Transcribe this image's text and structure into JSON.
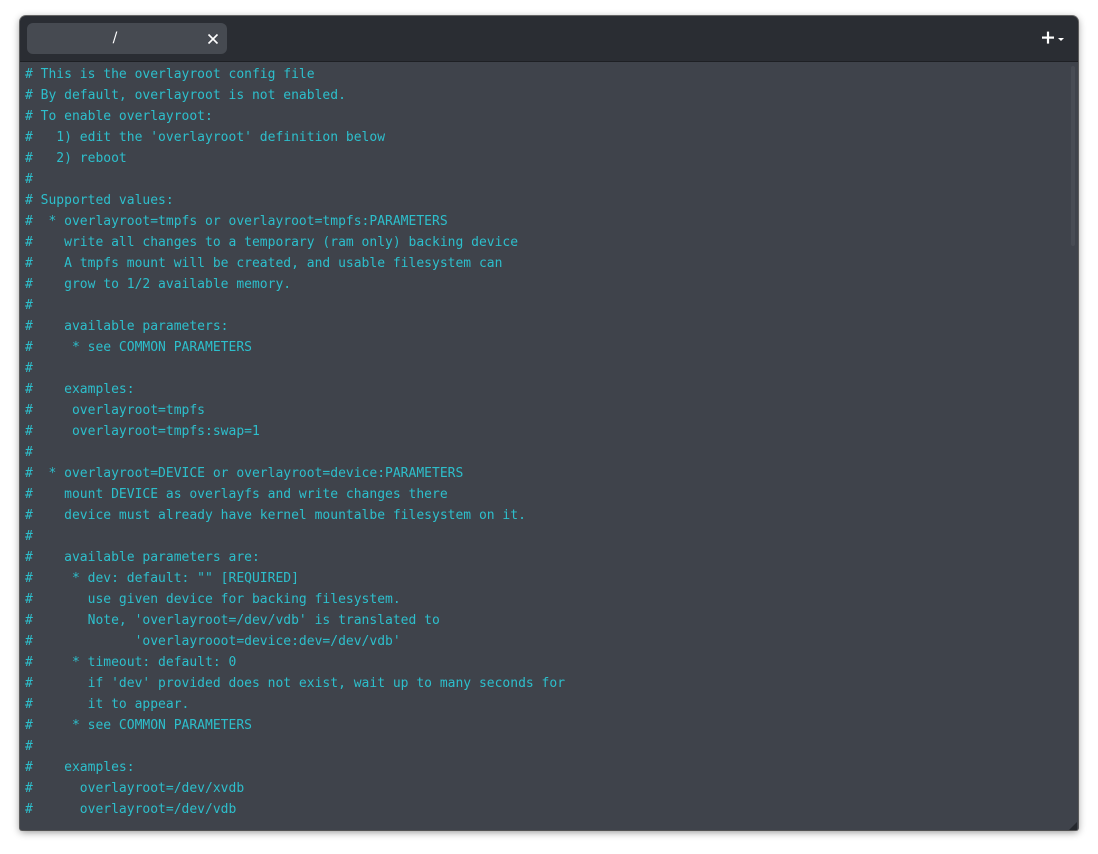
{
  "window": {
    "tab_title": "/",
    "colors": {
      "titlebar": "#2a2d33",
      "tab": "#464a51",
      "background": "#3f434b",
      "text": "#2dbfcc"
    }
  },
  "terminal": {
    "lines": [
      "# This is the overlayroot config file",
      "# By default, overlayroot is not enabled.",
      "# To enable overlayroot:",
      "#   1) edit the 'overlayroot' definition below",
      "#   2) reboot",
      "#",
      "# Supported values:",
      "#  * overlayroot=tmpfs or overlayroot=tmpfs:PARAMETERS",
      "#    write all changes to a temporary (ram only) backing device",
      "#    A tmpfs mount will be created, and usable filesystem can",
      "#    grow to 1/2 available memory.",
      "#",
      "#    available parameters:",
      "#     * see COMMON PARAMETERS",
      "#",
      "#    examples:",
      "#     overlayroot=tmpfs",
      "#     overlayroot=tmpfs:swap=1",
      "#",
      "#  * overlayroot=DEVICE or overlayroot=device:PARAMETERS",
      "#    mount DEVICE as overlayfs and write changes there",
      "#    device must already have kernel mountalbe filesystem on it.",
      "#",
      "#    available parameters are:",
      "#     * dev: default: \"\" [REQUIRED]",
      "#       use given device for backing filesystem.",
      "#       Note, 'overlayroot=/dev/vdb' is translated to",
      "#             'overlayrooot=device:dev=/dev/vdb'",
      "#     * timeout: default: 0",
      "#       if 'dev' provided does not exist, wait up to many seconds for",
      "#       it to appear.",
      "#     * see COMMON PARAMETERS",
      "#",
      "#    examples:",
      "#      overlayroot=/dev/xvdb",
      "#      overlayroot=/dev/vdb"
    ]
  },
  "icons": {
    "tab_close": "close-icon",
    "new_tab": "plus-icon",
    "new_tab_menu": "chevron-down-icon",
    "resize": "resize-grip-icon"
  }
}
